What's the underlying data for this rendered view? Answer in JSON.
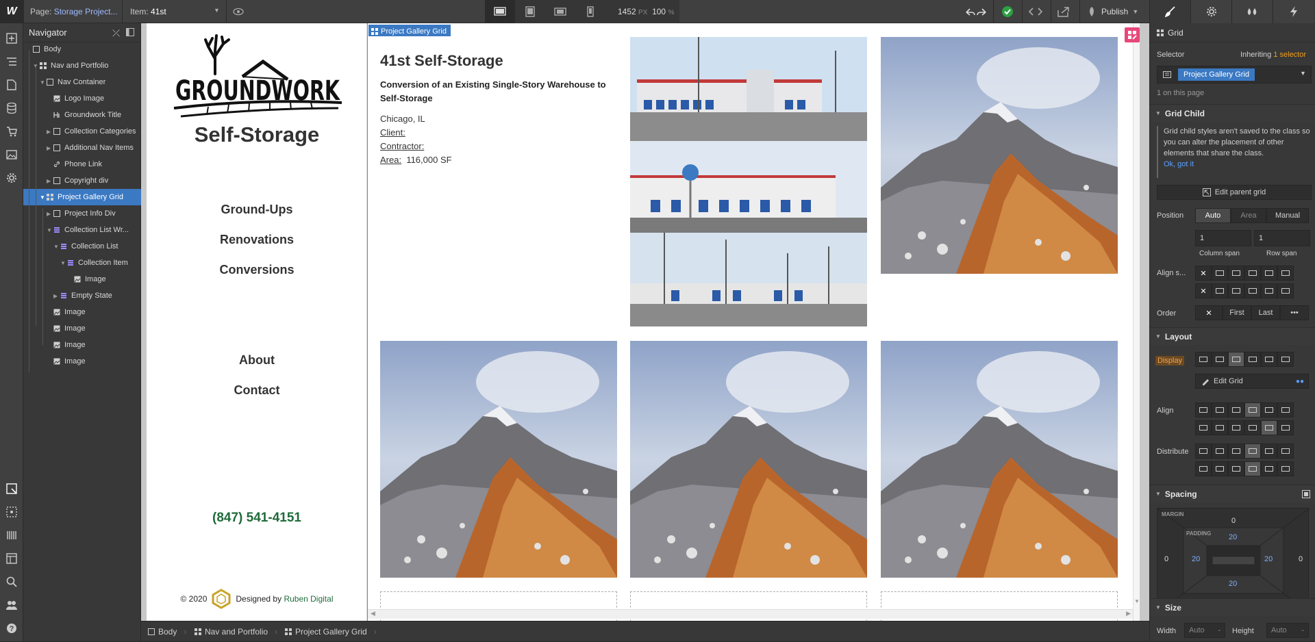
{
  "topbar": {
    "logo": "W",
    "page_label": "Page:",
    "page_value": "Storage Project...",
    "item_label": "Item:",
    "item_value": "41st",
    "width_value": "1452",
    "width_unit": "PX",
    "zoom_value": "100",
    "zoom_unit": "%",
    "publish_label": "Publish"
  },
  "navigator": {
    "title": "Navigator",
    "items": [
      {
        "label": "Body",
        "depth": 0,
        "icon": "box-icon"
      },
      {
        "label": "Nav and Portfolio",
        "depth": 1,
        "icon": "grid-icon",
        "caret": "▼"
      },
      {
        "label": "Nav Container",
        "depth": 2,
        "icon": "box-icon",
        "caret": "▼"
      },
      {
        "label": "Logo Image",
        "depth": 3,
        "icon": "image-icon"
      },
      {
        "label": "Groundwork Title",
        "depth": 3,
        "icon": "heading-icon"
      },
      {
        "label": "Collection Categories",
        "depth": 3,
        "icon": "box-icon",
        "caret": "▶"
      },
      {
        "label": "Additional Nav Items",
        "depth": 3,
        "icon": "box-icon",
        "caret": "▶"
      },
      {
        "label": "Phone Link",
        "depth": 3,
        "icon": "link-icon"
      },
      {
        "label": "Copyright div",
        "depth": 3,
        "icon": "box-icon",
        "caret": "▶"
      },
      {
        "label": "Project Gallery Grid",
        "depth": 2,
        "icon": "grid-icon",
        "caret": "▼",
        "selected": true
      },
      {
        "label": "Project Info Div",
        "depth": 3,
        "icon": "box-icon",
        "caret": "▶"
      },
      {
        "label": "Collection List Wr...",
        "depth": 3,
        "icon": "collection-icon",
        "caret": "▼"
      },
      {
        "label": "Collection List",
        "depth": 4,
        "icon": "collection-icon",
        "caret": "▼"
      },
      {
        "label": "Collection Item",
        "depth": 5,
        "icon": "collection-icon",
        "caret": "▼"
      },
      {
        "label": "Image",
        "depth": 6,
        "icon": "image-icon"
      },
      {
        "label": "Empty State",
        "depth": 4,
        "icon": "collection-icon",
        "caret": "▶"
      },
      {
        "label": "Image",
        "depth": 3,
        "icon": "image-icon"
      },
      {
        "label": "Image",
        "depth": 3,
        "icon": "image-icon"
      },
      {
        "label": "Image",
        "depth": 3,
        "icon": "image-icon"
      },
      {
        "label": "Image",
        "depth": 3,
        "icon": "image-icon"
      }
    ]
  },
  "site": {
    "logo_text": "GROUNDWORK",
    "title": "Self-Storage",
    "nav_links": [
      "Ground-Ups",
      "Renovations",
      "Conversions"
    ],
    "extra_links": [
      "About",
      "Contact"
    ],
    "phone": "(847) 541-4151",
    "copyright": "© 2020",
    "designed_by": "Designed by",
    "designer": "Ruben Digital"
  },
  "grid": {
    "tag_label": "Project Gallery Grid",
    "project_title": "41st Self-Storage",
    "project_subtitle": "Conversion of an Existing Single-Story Warehouse to Self-Storage",
    "location": "Chicago, IL",
    "client_label": "Client:",
    "contractor_label": "Contractor:",
    "area_label": "Area:",
    "area_value": "116,000 SF"
  },
  "breadcrumbs": [
    "Body",
    "Nav and Portfolio",
    "Project Gallery Grid"
  ],
  "panel": {
    "element_type": "Grid",
    "selector_label": "Selector",
    "inheriting_label": "Inheriting",
    "inheriting_count": "1 selector",
    "selector_chip": "Project Gallery Grid",
    "on_page": "1 on this page",
    "grid_child": {
      "title": "Grid Child",
      "note": "Grid child styles aren't saved to the class so you can alter the placement of other elements that share the class.",
      "ok_link": "Ok, got it",
      "edit_parent": "Edit parent grid",
      "position_label": "Position",
      "position_options": [
        "Auto",
        "Area",
        "Manual"
      ],
      "column_span_value": "1",
      "row_span_value": "1",
      "column_span_label": "Column span",
      "row_span_label": "Row span",
      "align_label": "Align s...",
      "order_label": "Order",
      "order_options": [
        "First",
        "Last",
        "•••"
      ]
    },
    "layout": {
      "title": "Layout",
      "display_label": "Display",
      "edit_grid": "Edit Grid",
      "align_label": "Align",
      "distribute_label": "Distribute"
    },
    "spacing": {
      "title": "Spacing",
      "margin_label": "MARGIN",
      "padding_label": "PADDING",
      "margin_top": "0",
      "margin_right": "0",
      "margin_bottom": "0",
      "margin_left": "0",
      "padding_top": "20",
      "padding_right": "20",
      "padding_bottom": "20",
      "padding_left": "20"
    },
    "size": {
      "title": "Size",
      "width_label": "Width",
      "width_value": "Auto",
      "height_label": "Height",
      "height_value": "Auto",
      "dash": "-"
    }
  },
  "colors": {
    "accent_blue": "#3b79c3",
    "phone_green": "#1f6b3a",
    "publish_check": "#2ea043",
    "margin_pink": "#e8477a"
  }
}
